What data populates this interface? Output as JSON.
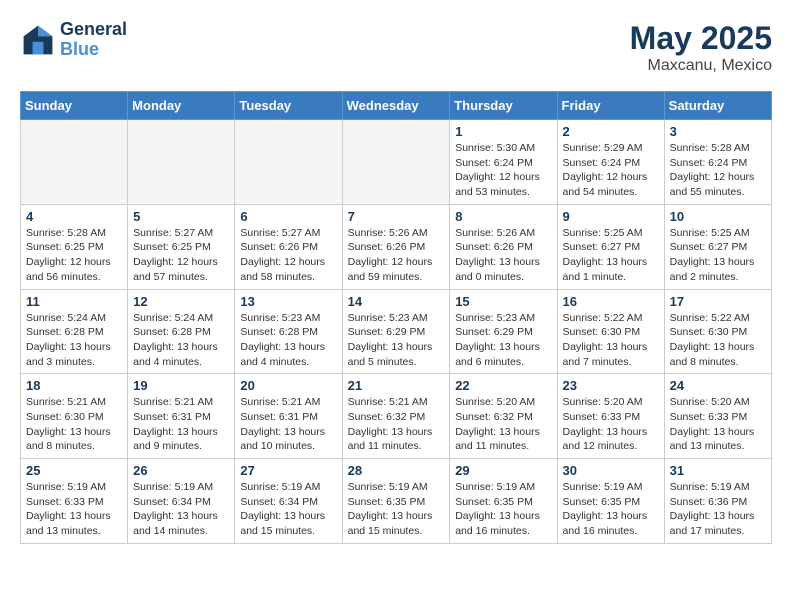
{
  "logo": {
    "line1": "General",
    "line2": "Blue"
  },
  "title": "May 2025",
  "location": "Maxcanu, Mexico",
  "days_of_week": [
    "Sunday",
    "Monday",
    "Tuesday",
    "Wednesday",
    "Thursday",
    "Friday",
    "Saturday"
  ],
  "weeks": [
    [
      {
        "day": "",
        "info": "",
        "empty": true
      },
      {
        "day": "",
        "info": "",
        "empty": true
      },
      {
        "day": "",
        "info": "",
        "empty": true
      },
      {
        "day": "",
        "info": "",
        "empty": true
      },
      {
        "day": "1",
        "info": "Sunrise: 5:30 AM\nSunset: 6:24 PM\nDaylight: 12 hours\nand 53 minutes.",
        "empty": false
      },
      {
        "day": "2",
        "info": "Sunrise: 5:29 AM\nSunset: 6:24 PM\nDaylight: 12 hours\nand 54 minutes.",
        "empty": false
      },
      {
        "day": "3",
        "info": "Sunrise: 5:28 AM\nSunset: 6:24 PM\nDaylight: 12 hours\nand 55 minutes.",
        "empty": false
      }
    ],
    [
      {
        "day": "4",
        "info": "Sunrise: 5:28 AM\nSunset: 6:25 PM\nDaylight: 12 hours\nand 56 minutes.",
        "empty": false
      },
      {
        "day": "5",
        "info": "Sunrise: 5:27 AM\nSunset: 6:25 PM\nDaylight: 12 hours\nand 57 minutes.",
        "empty": false
      },
      {
        "day": "6",
        "info": "Sunrise: 5:27 AM\nSunset: 6:26 PM\nDaylight: 12 hours\nand 58 minutes.",
        "empty": false
      },
      {
        "day": "7",
        "info": "Sunrise: 5:26 AM\nSunset: 6:26 PM\nDaylight: 12 hours\nand 59 minutes.",
        "empty": false
      },
      {
        "day": "8",
        "info": "Sunrise: 5:26 AM\nSunset: 6:26 PM\nDaylight: 13 hours\nand 0 minutes.",
        "empty": false
      },
      {
        "day": "9",
        "info": "Sunrise: 5:25 AM\nSunset: 6:27 PM\nDaylight: 13 hours\nand 1 minute.",
        "empty": false
      },
      {
        "day": "10",
        "info": "Sunrise: 5:25 AM\nSunset: 6:27 PM\nDaylight: 13 hours\nand 2 minutes.",
        "empty": false
      }
    ],
    [
      {
        "day": "11",
        "info": "Sunrise: 5:24 AM\nSunset: 6:28 PM\nDaylight: 13 hours\nand 3 minutes.",
        "empty": false
      },
      {
        "day": "12",
        "info": "Sunrise: 5:24 AM\nSunset: 6:28 PM\nDaylight: 13 hours\nand 4 minutes.",
        "empty": false
      },
      {
        "day": "13",
        "info": "Sunrise: 5:23 AM\nSunset: 6:28 PM\nDaylight: 13 hours\nand 4 minutes.",
        "empty": false
      },
      {
        "day": "14",
        "info": "Sunrise: 5:23 AM\nSunset: 6:29 PM\nDaylight: 13 hours\nand 5 minutes.",
        "empty": false
      },
      {
        "day": "15",
        "info": "Sunrise: 5:23 AM\nSunset: 6:29 PM\nDaylight: 13 hours\nand 6 minutes.",
        "empty": false
      },
      {
        "day": "16",
        "info": "Sunrise: 5:22 AM\nSunset: 6:30 PM\nDaylight: 13 hours\nand 7 minutes.",
        "empty": false
      },
      {
        "day": "17",
        "info": "Sunrise: 5:22 AM\nSunset: 6:30 PM\nDaylight: 13 hours\nand 8 minutes.",
        "empty": false
      }
    ],
    [
      {
        "day": "18",
        "info": "Sunrise: 5:21 AM\nSunset: 6:30 PM\nDaylight: 13 hours\nand 8 minutes.",
        "empty": false
      },
      {
        "day": "19",
        "info": "Sunrise: 5:21 AM\nSunset: 6:31 PM\nDaylight: 13 hours\nand 9 minutes.",
        "empty": false
      },
      {
        "day": "20",
        "info": "Sunrise: 5:21 AM\nSunset: 6:31 PM\nDaylight: 13 hours\nand 10 minutes.",
        "empty": false
      },
      {
        "day": "21",
        "info": "Sunrise: 5:21 AM\nSunset: 6:32 PM\nDaylight: 13 hours\nand 11 minutes.",
        "empty": false
      },
      {
        "day": "22",
        "info": "Sunrise: 5:20 AM\nSunset: 6:32 PM\nDaylight: 13 hours\nand 11 minutes.",
        "empty": false
      },
      {
        "day": "23",
        "info": "Sunrise: 5:20 AM\nSunset: 6:33 PM\nDaylight: 13 hours\nand 12 minutes.",
        "empty": false
      },
      {
        "day": "24",
        "info": "Sunrise: 5:20 AM\nSunset: 6:33 PM\nDaylight: 13 hours\nand 13 minutes.",
        "empty": false
      }
    ],
    [
      {
        "day": "25",
        "info": "Sunrise: 5:19 AM\nSunset: 6:33 PM\nDaylight: 13 hours\nand 13 minutes.",
        "empty": false
      },
      {
        "day": "26",
        "info": "Sunrise: 5:19 AM\nSunset: 6:34 PM\nDaylight: 13 hours\nand 14 minutes.",
        "empty": false
      },
      {
        "day": "27",
        "info": "Sunrise: 5:19 AM\nSunset: 6:34 PM\nDaylight: 13 hours\nand 15 minutes.",
        "empty": false
      },
      {
        "day": "28",
        "info": "Sunrise: 5:19 AM\nSunset: 6:35 PM\nDaylight: 13 hours\nand 15 minutes.",
        "empty": false
      },
      {
        "day": "29",
        "info": "Sunrise: 5:19 AM\nSunset: 6:35 PM\nDaylight: 13 hours\nand 16 minutes.",
        "empty": false
      },
      {
        "day": "30",
        "info": "Sunrise: 5:19 AM\nSunset: 6:35 PM\nDaylight: 13 hours\nand 16 minutes.",
        "empty": false
      },
      {
        "day": "31",
        "info": "Sunrise: 5:19 AM\nSunset: 6:36 PM\nDaylight: 13 hours\nand 17 minutes.",
        "empty": false
      }
    ]
  ]
}
